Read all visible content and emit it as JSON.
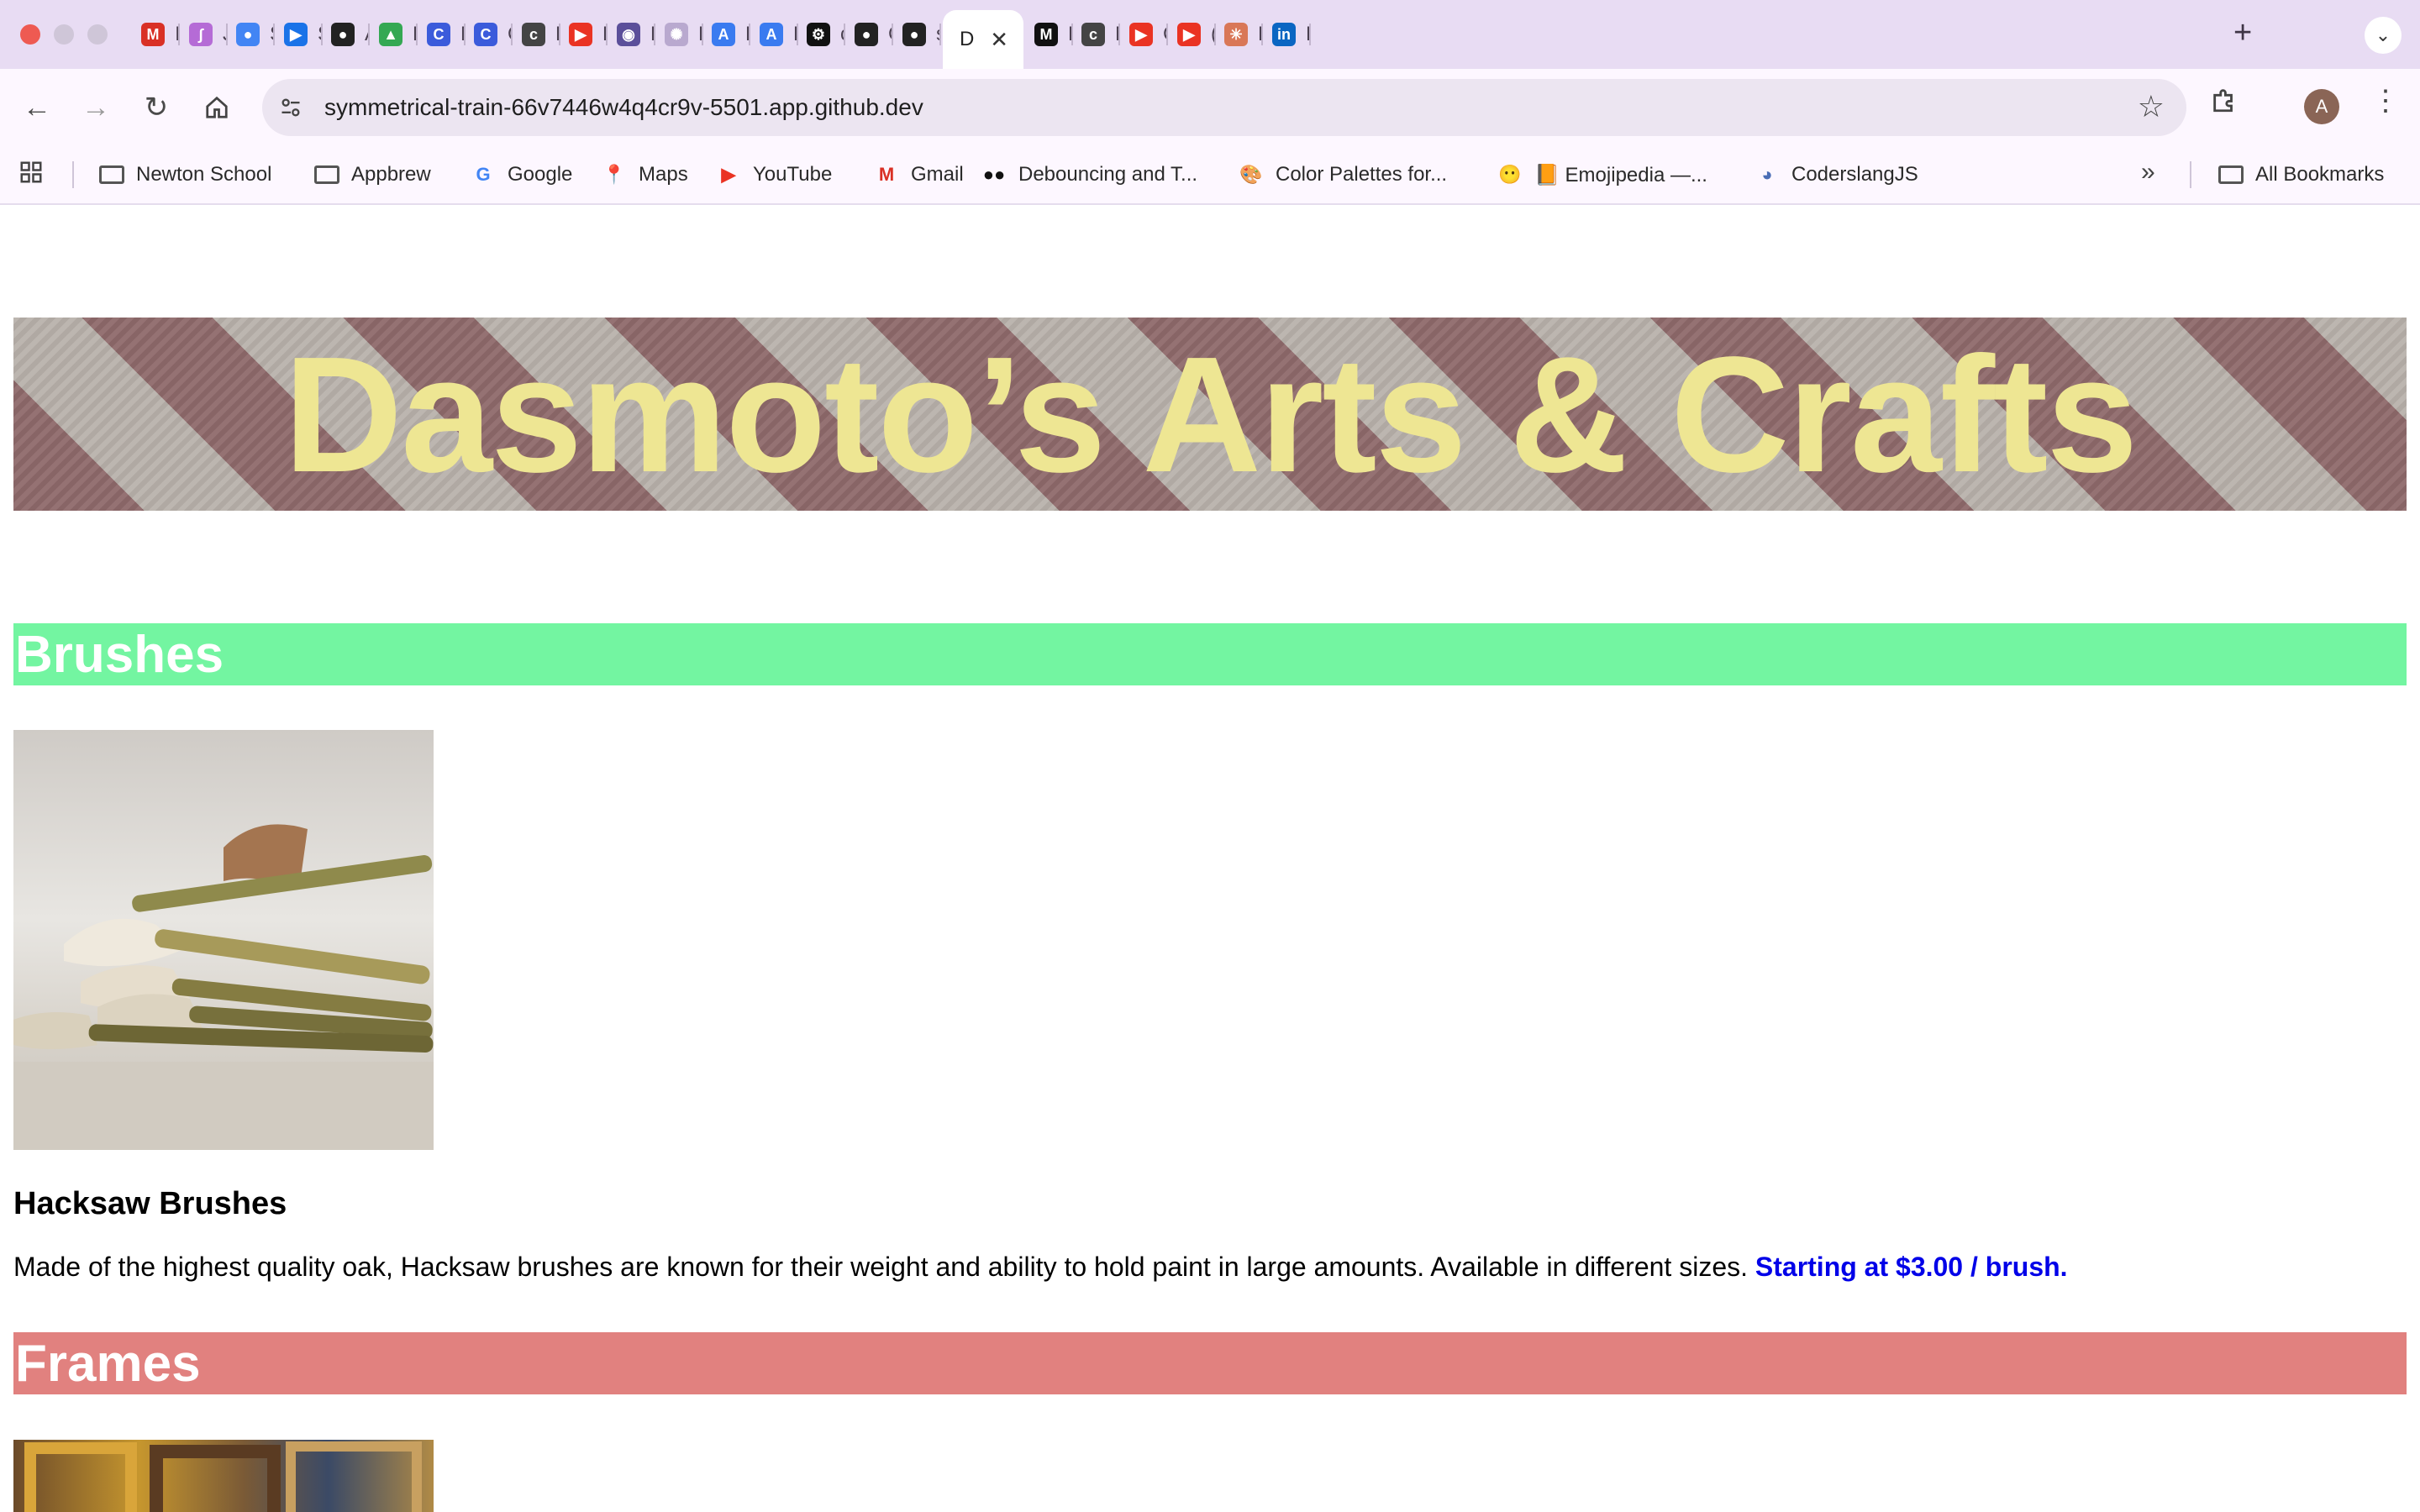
{
  "browser": {
    "tabs": [
      {
        "title": "In",
        "icon": "gmail-icon",
        "color": "#d93025",
        "glyph": "M"
      },
      {
        "title": "J",
        "icon": "pen-icon",
        "color": "#b56bd6",
        "glyph": "∫"
      },
      {
        "title": "S",
        "icon": "chrome-icon",
        "color": "#4285f4",
        "glyph": "●"
      },
      {
        "title": "S",
        "icon": "video-icon",
        "color": "#1a73e8",
        "glyph": "▶"
      },
      {
        "title": "A",
        "icon": "github-icon",
        "color": "#222222",
        "glyph": "●"
      },
      {
        "title": "F",
        "icon": "drive-icon",
        "color": "#34a853",
        "glyph": "▲"
      },
      {
        "title": "M",
        "icon": "c-logo-icon",
        "color": "#3b5bdb",
        "glyph": "C"
      },
      {
        "title": "C",
        "icon": "c-logo-icon",
        "color": "#3b5bdb",
        "glyph": "C"
      },
      {
        "title": "D",
        "icon": "codepen-icon",
        "color": "#444444",
        "glyph": "c"
      },
      {
        "title": "H",
        "icon": "youtube-icon",
        "color": "#ea3323",
        "glyph": "▶"
      },
      {
        "title": "H",
        "icon": "circle-logo-icon",
        "color": "#5b4f9a",
        "glyph": "◉"
      },
      {
        "title": "L",
        "icon": "openai-icon",
        "color": "#b9a9cf",
        "glyph": "✺"
      },
      {
        "title": "H",
        "icon": "arrow-logo-icon",
        "color": "#3a7bf0",
        "glyph": "A"
      },
      {
        "title": "F",
        "icon": "arrow-logo-icon",
        "color": "#3a7bf0",
        "glyph": "A"
      },
      {
        "title": "c",
        "icon": "dots-logo-icon",
        "color": "#111111",
        "glyph": "⚙"
      },
      {
        "title": "C",
        "icon": "github-icon",
        "color": "#222222",
        "glyph": "●"
      },
      {
        "title": "s",
        "icon": "github-icon",
        "color": "#222222",
        "glyph": "●"
      },
      {
        "title": "D",
        "icon": "page-icon",
        "color": "#ffffff",
        "glyph": "",
        "active": true
      },
      {
        "title": "L",
        "icon": "m-logo-icon",
        "color": "#111111",
        "glyph": "M"
      },
      {
        "title": "N",
        "icon": "codepen-icon",
        "color": "#444444",
        "glyph": "c"
      },
      {
        "title": "C",
        "icon": "youtube-icon",
        "color": "#ea3323",
        "glyph": "▶"
      },
      {
        "title": "(",
        "icon": "youtube-icon",
        "color": "#ea3323",
        "glyph": "▶"
      },
      {
        "title": "F",
        "icon": "sparkle-icon",
        "color": "#d97757",
        "glyph": "✳"
      },
      {
        "title": "F",
        "icon": "linkedin-icon",
        "color": "#0a66c2",
        "glyph": "in"
      }
    ],
    "url": "symmetrical-train-66v7446w4q4cr9v-5501.app.github.dev",
    "avatar_letter": "A",
    "bookmarks": [
      {
        "label": "Newton School",
        "type": "folder"
      },
      {
        "label": "Appbrew",
        "type": "folder"
      },
      {
        "label": "Google",
        "type": "site",
        "glyph": "G",
        "color": "#4285f4"
      },
      {
        "label": "Maps",
        "type": "site",
        "glyph": "📍",
        "color": "#34a853"
      },
      {
        "label": "YouTube",
        "type": "site",
        "glyph": "▶",
        "color": "#ea3323"
      },
      {
        "label": "Gmail",
        "type": "site",
        "glyph": "M",
        "color": "#d93025"
      },
      {
        "label": "Debouncing and T...",
        "type": "site",
        "glyph": "●●",
        "color": "#111111"
      },
      {
        "label": "Color Palettes for...",
        "type": "site",
        "glyph": "🎨",
        "color": "#7a4fa0"
      },
      {
        "label": "📙 Emojipedia —...",
        "type": "site",
        "glyph": "😶",
        "color": "#e0a030"
      },
      {
        "label": "CoderslangJS",
        "type": "site",
        "glyph": "◕",
        "color": "#4a6db5"
      }
    ],
    "all_bookmarks_label": "All Bookmarks"
  },
  "page": {
    "banner_title": "Dasmoto’s Arts & Crafts",
    "sections": [
      {
        "heading": "Brushes",
        "color": "#73f5a1",
        "product_title": "Hacksaw Brushes",
        "description": "Made of the highest quality oak, Hacksaw brushes are known for their weight and ability to hold paint in large amounts. Available in different sizes.",
        "price": "Starting at $3.00 / brush."
      },
      {
        "heading": "Frames",
        "color": "#e1817f"
      }
    ]
  }
}
